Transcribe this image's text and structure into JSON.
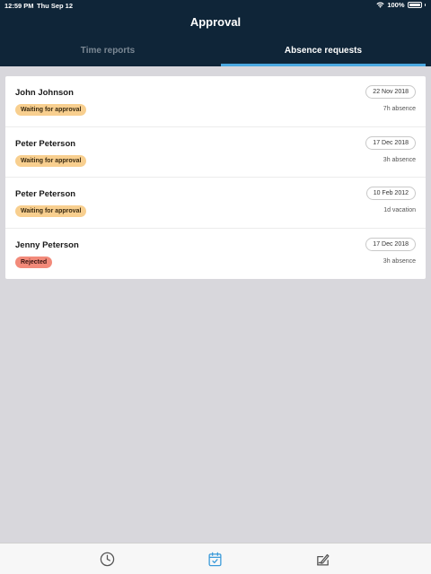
{
  "status_bar": {
    "time": "12:59 PM",
    "date": "Thu Sep 12",
    "battery": "100%"
  },
  "header": {
    "title": "Approval"
  },
  "tabs": [
    {
      "label": "Time reports",
      "active": false
    },
    {
      "label": "Absence requests",
      "active": true
    }
  ],
  "requests": [
    {
      "name": "John Johnson",
      "status": "Waiting for approval",
      "date": "22 Nov 2018",
      "detail": "7h absence"
    },
    {
      "name": "Peter Peterson",
      "status": "Waiting for approval",
      "date": "17 Dec 2018",
      "detail": "3h absence"
    },
    {
      "name": "Peter Peterson",
      "status": "Waiting for approval",
      "date": "10 Feb 2012",
      "detail": "1d vacation"
    },
    {
      "name": "Jenny Peterson",
      "status": "Rejected",
      "date": "17 Dec 2018",
      "detail": "3h absence"
    }
  ],
  "bottom_nav": [
    {
      "icon": "clock-icon",
      "active": false
    },
    {
      "icon": "calendar-check-icon",
      "active": true
    },
    {
      "icon": "sign-document-icon",
      "active": false
    }
  ],
  "colors": {
    "header_bg": "#0f2538",
    "accent": "#4aa8e0",
    "waiting_badge": "#f8cf8f",
    "rejected_badge": "#f28a7a",
    "page_bg": "#d8d7dc"
  }
}
